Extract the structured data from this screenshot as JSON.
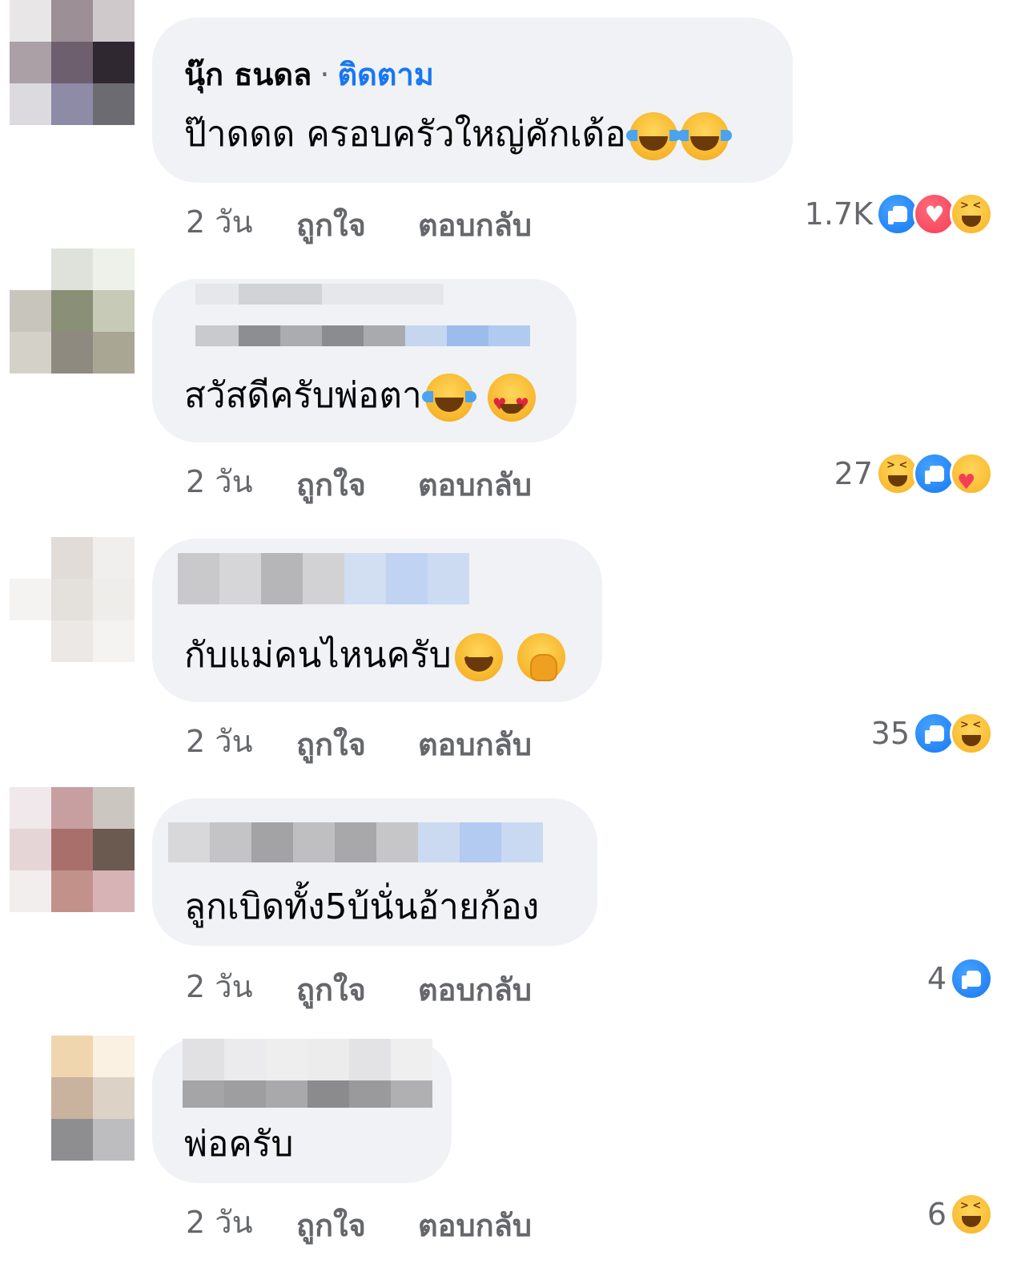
{
  "comments": [
    {
      "author": "นุ๊ก ธนดล",
      "separator": "·",
      "follow_label": "ติดตาม",
      "text": "ป๊าดดด ครอบครัวใหญ่คักเด้อ",
      "emojis": [
        "laughing-tears",
        "laughing-tears"
      ],
      "time": "2 วัน",
      "like_label": "ถูกใจ",
      "reply_label": "ตอบกลับ",
      "reaction_count": "1.7K",
      "reactions": [
        "like",
        "love",
        "haha"
      ]
    },
    {
      "author": "",
      "text": "สวัสดีครับพ่อตา",
      "emojis": [
        "laughing-tears",
        "heart-eyes"
      ],
      "time": "2 วัน",
      "like_label": "ถูกใจ",
      "reply_label": "ตอบกลับ",
      "reaction_count": "27",
      "reactions": [
        "haha",
        "like",
        "care"
      ]
    },
    {
      "author": "",
      "text": "กับแม่คนไหนครับ",
      "emojis": [
        "grinning-squint",
        "face-with-hand"
      ],
      "time": "2 วัน",
      "like_label": "ถูกใจ",
      "reply_label": "ตอบกลับ",
      "reaction_count": "35",
      "reactions": [
        "like",
        "haha"
      ]
    },
    {
      "author": "",
      "text": "ลูกเบิดทั้ง5บ้นั่นอ้ายก้อง",
      "emojis": [],
      "time": "2 วัน",
      "like_label": "ถูกใจ",
      "reply_label": "ตอบกลับ",
      "reaction_count": "4",
      "reactions": [
        "like"
      ]
    },
    {
      "author": "",
      "text": "พ่อครับ",
      "emojis": [],
      "time": "2 วัน",
      "like_label": "ถูกใจ",
      "reply_label": "ตอบกลับ",
      "reaction_count": "6",
      "reactions": [
        "haha"
      ]
    }
  ],
  "colors": {
    "bubble": "#f0f2f5",
    "follow": "#1877f2",
    "meta_text": "#65676b",
    "like_blue": "#1877f2",
    "love_red": "#f33e58",
    "haha_yellow": "#f7b125"
  }
}
